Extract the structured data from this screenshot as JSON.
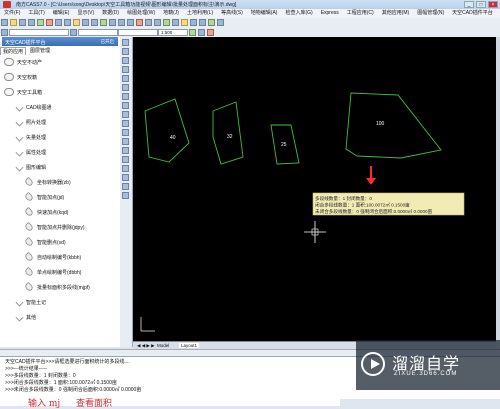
{
  "window": {
    "title": "南方CASS7.0 - [C:\\Users\\song\\Desktop\\天空工具箱功能视频\\图形编辑\\批量处理面积标注\\演示.dwg]",
    "buttons": {
      "minimize": "_",
      "maximize": "□",
      "close": "×"
    }
  },
  "menu": [
    "文件(F)",
    "工具(T)",
    "编辑(E)",
    "显示(V)",
    "数据(D)",
    "绘图处理(W)",
    "地籍(J)",
    "土地利用(L)",
    "等高线(S)",
    "地物编辑(A)",
    "检查入库(G)",
    "Express",
    "工程应用(C)",
    "其他应用(M)",
    "图幅管理(N)",
    "天空CAD插件平台"
  ],
  "toolbar": {
    "zoom_label": "1:500"
  },
  "left_panel": {
    "title": "天空CAD插件平台",
    "open_button": "已开启",
    "tabs": [
      "我的应用",
      "图层管理"
    ],
    "tree": [
      {
        "label": "天空不动产",
        "icon": "cloud-icon",
        "level": 0
      },
      {
        "label": "天空权籍",
        "icon": "cloud-icon",
        "level": 0
      },
      {
        "label": "天空工具箱",
        "icon": "cloud-icon",
        "level": 0
      },
      {
        "label": "CAD绘图通",
        "icon": "chevron-icon",
        "level": 1
      },
      {
        "label": "照片处理",
        "icon": "chevron-icon",
        "level": 1
      },
      {
        "label": "矢量处理",
        "icon": "chevron-icon",
        "level": 1
      },
      {
        "label": "属性处理",
        "icon": "chevron-icon",
        "level": 1
      },
      {
        "label": "图形编辑",
        "icon": "chevron-icon",
        "level": 1
      },
      {
        "label": "坐标转换器(zb)",
        "icon": "leaf-icon",
        "level": 2
      },
      {
        "label": "智能加点(jd)",
        "icon": "leaf-icon",
        "level": 2
      },
      {
        "label": "快速加点(kqd)",
        "icon": "leaf-icon",
        "level": 2
      },
      {
        "label": "智能加点并删除(jdpy)",
        "icon": "leaf-icon",
        "level": 2
      },
      {
        "label": "智能删点(sd)",
        "icon": "leaf-icon",
        "level": 2
      },
      {
        "label": "自动绘制编号(kbbh)",
        "icon": "leaf-icon",
        "level": 2
      },
      {
        "label": "单点绘制编号(dbbh)",
        "icon": "leaf-icon",
        "level": 2
      },
      {
        "label": "批量标面积多段线(mjpf)",
        "icon": "leaf-icon",
        "level": 2
      },
      {
        "label": "智能土记",
        "icon": "chevron-icon",
        "level": 1
      },
      {
        "label": "其他",
        "icon": "chevron-icon",
        "level": 1
      }
    ]
  },
  "canvas": {
    "polygon_labels": [
      "40",
      "32",
      "25",
      "100"
    ],
    "info_box": [
      "多段线数量：1 封闭数量：0",
      "闭合多段线数量：1 面积:100.0072㎡  0.1500亩",
      "未闭合多段线数量：0  强制闭合后面积:0.0000㎡  0.0000亩"
    ],
    "tabs": [
      "Model",
      "Layout1"
    ],
    "colors": {
      "background": "#000000",
      "polygons": "#3fbf3f",
      "info_box": "#f2ecb4",
      "arrow": "#ff2a2a"
    }
  },
  "command": {
    "lines": [
      "天空CAD插件平台>>>请框选要进行面积统计的多段线....",
      ">>>---统计结果-----",
      ">>>多段线数量：1 封闭数量：0",
      ">>>闭合多段线数量：1  面积:100.0072㎡  0.1500亩",
      ">>>未闭合多段线数量：0  强制闭合后面积:0.0000㎡  0.0000亩"
    ],
    "input_text": "输入 mj",
    "hint": "查看面积"
  },
  "watermark": {
    "brand": "溜溜自学",
    "url": "ZIXUE.3D66.COM"
  }
}
